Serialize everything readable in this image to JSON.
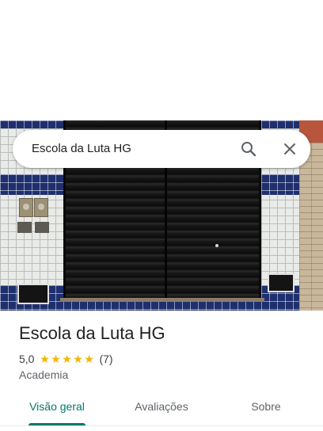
{
  "search": {
    "query": "Escola da Luta HG"
  },
  "place": {
    "name": "Escola da Luta HG",
    "rating": "5,0",
    "stars": 5,
    "review_count": "(7)",
    "category": "Academia"
  },
  "tabs": [
    {
      "label": "Visão geral",
      "active": true
    },
    {
      "label": "Avaliações",
      "active": false
    },
    {
      "label": "Sobre",
      "active": false
    }
  ],
  "colors": {
    "accent": "#00796b",
    "star": "#f4b400",
    "text_primary": "#202124",
    "text_secondary": "#5f6368"
  },
  "icons": {
    "search": "search-icon",
    "close": "close-icon"
  }
}
